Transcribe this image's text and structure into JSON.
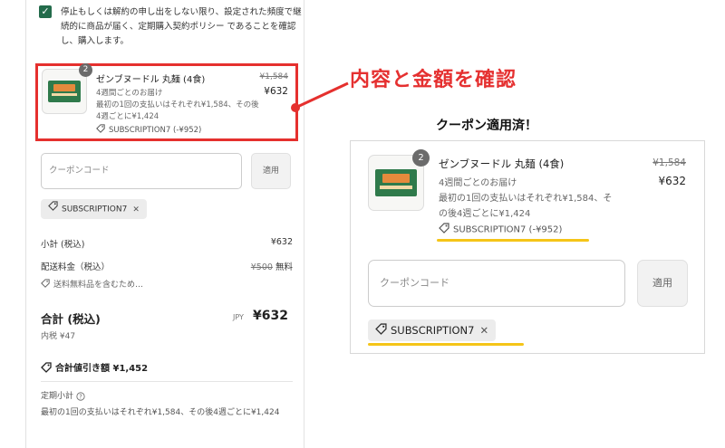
{
  "consent": {
    "text": "停止もしくは解約の申し出をしない限り、設定された頻度で継続的に商品が届く、定期購入契約ポリシー であることを確認し、購入します。"
  },
  "item": {
    "quantity": "2",
    "name": "ゼンブヌードル 丸麺 (4食)",
    "original_price": "¥1,584",
    "price": "¥632",
    "frequency": "4週間ごとのお届け",
    "description": "最初の1回の支払いはそれぞれ¥1,584、その後4週ごとに¥1,424",
    "discount": "SUBSCRIPTION7 (-¥952)"
  },
  "coupon": {
    "placeholder": "クーポンコード",
    "apply_label": "適用",
    "applied_code": "SUBSCRIPTION7"
  },
  "summary": {
    "subtotal_label": "小計 (税込)",
    "subtotal_value": "¥632",
    "shipping_label": "配送料金（税込）",
    "shipping_old": "¥500",
    "shipping_value": "無料",
    "shipping_note": "送料無料品を含むため…",
    "total_label": "合計 (税込)",
    "currency": "JPY",
    "total_value": "¥632",
    "tax_note": "内税 ¥47",
    "savings": "合計値引き額 ¥1,452",
    "recurring_label": "定期小計",
    "recurring_desc": "最初の1回の支払いはそれぞれ¥1,584、その後4週ごとに¥1,424"
  },
  "annotation": {
    "main": "内容と金額を確認",
    "sub": "クーポン適用済！"
  },
  "colors": {
    "highlight_box": "#e5302e",
    "highlight_underline": "#f5c518",
    "checkbox": "#236b4b"
  }
}
